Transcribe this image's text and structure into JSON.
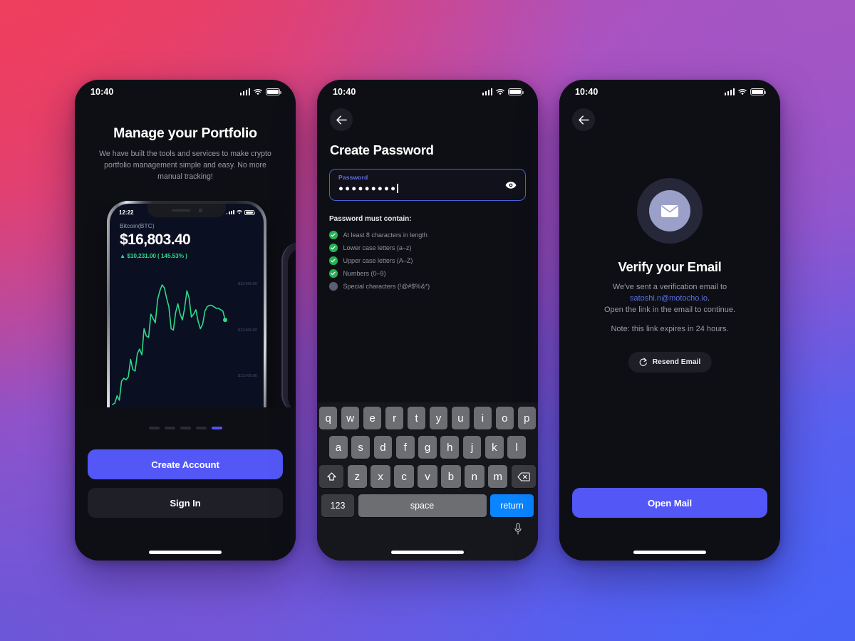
{
  "screens": [
    {
      "id": "onboarding",
      "statusbar": {
        "time": "10:40"
      },
      "title": "Manage your Portfolio",
      "subtitle": "We have built the tools and services to make crypto portfolio management simple and easy. No more manual tracking!",
      "mockup": {
        "statusbar_time": "12:22",
        "coin": "Bitcoin(BTC)",
        "price": "$16,803.40",
        "change": "▲ $10,231.00 ( 145.53% )",
        "y_labels": [
          "$13,000.00",
          "$13,000.00",
          "$13,000.00"
        ]
      },
      "pagination": {
        "count": 5,
        "active_index": 4
      },
      "primary_button": "Create Account",
      "secondary_button": "Sign In"
    },
    {
      "id": "create-password",
      "statusbar": {
        "time": "10:40"
      },
      "title": "Create Password",
      "field": {
        "label": "Password",
        "value": "●●●●●●●●●",
        "masked": true
      },
      "requirements_heading": "Password must contain:",
      "requirements": [
        {
          "text": "At least 8 characters in length",
          "met": true
        },
        {
          "text": "Lower case letters (a–z)",
          "met": true
        },
        {
          "text": "Upper case letters (A–Z)",
          "met": true
        },
        {
          "text": "Numbers (0–9)",
          "met": true
        },
        {
          "text": "Special characters (!@#$%&*)",
          "met": false
        }
      ],
      "keyboard": {
        "row1": [
          "q",
          "w",
          "e",
          "r",
          "t",
          "y",
          "u",
          "i",
          "o",
          "p"
        ],
        "row2": [
          "a",
          "s",
          "d",
          "f",
          "g",
          "h",
          "j",
          "k",
          "l"
        ],
        "row3": [
          "z",
          "x",
          "c",
          "v",
          "b",
          "n",
          "m"
        ],
        "numeric_key": "123",
        "space_key": "space",
        "return_key": "return"
      }
    },
    {
      "id": "verify-email",
      "statusbar": {
        "time": "10:40"
      },
      "title": "Verify your Email",
      "body_line1": "We've sent a verification email to",
      "email": "satoshi.n@motocho.io",
      "body_line2": "Open the link in the email to continue.",
      "note": "Note: this link expires in 24 hours.",
      "resend_button": "Resend Email",
      "primary_button": "Open Mail"
    }
  ],
  "chart_data": {
    "type": "line",
    "title": "Bitcoin(BTC)",
    "ylabel": "",
    "xlabel": "",
    "grid": false,
    "legend": null,
    "y_tick_labels": [
      "$13,000.00",
      "$13,000.00",
      "$13,000.00"
    ],
    "series": [
      {
        "name": "BTC price",
        "color": "#2fd98a",
        "values": [
          6,
          7,
          12,
          9,
          22,
          24,
          23,
          25,
          37,
          30,
          29,
          41,
          44,
          40,
          58,
          53,
          52,
          68,
          65,
          62,
          78,
          84,
          88,
          86,
          79,
          73,
          58,
          57,
          69,
          75,
          68,
          64,
          72,
          84,
          79,
          66,
          68,
          71,
          63,
          58,
          61,
          70,
          73,
          74,
          74,
          73,
          72,
          72,
          71,
          70,
          64
        ]
      }
    ],
    "last_point": {
      "value": 64,
      "marker": true,
      "color": "#2fd98a"
    }
  },
  "colors": {
    "accent_blue": "#5257f6",
    "keyboard_return": "#0a84ff",
    "chart_green": "#2fd98a",
    "check_green": "#24b254",
    "field_border": "#4c60d8",
    "link": "#5a6fe8",
    "screen_bg": "#0e0f15",
    "bg_gradient_top_left": "#e8395e",
    "bg_gradient_top_right": "#a356c4",
    "bg_gradient_bottom_left": "#6b57d8",
    "bg_gradient_bottom_right": "#4a63f7"
  }
}
